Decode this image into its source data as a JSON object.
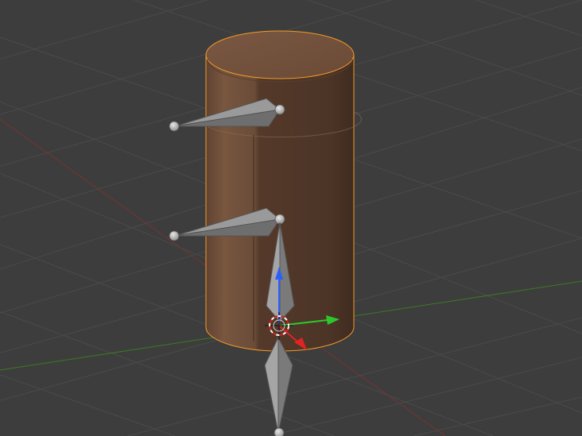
{
  "viewport": {
    "background": "#3d3d3d",
    "grid_color": "#4a4a4a",
    "x_axis_color": "#7a3232",
    "y_axis_color": "#3b7a23"
  },
  "scene": {
    "object": "cylinder",
    "object_color": "#6b4c38",
    "selection_outline_color": "#f39b28",
    "bones": [
      {
        "name": "upper-side-bone"
      },
      {
        "name": "middle-side-bone"
      },
      {
        "name": "vertical-upper-bone"
      },
      {
        "name": "vertical-lower-bone"
      }
    ]
  },
  "gizmo": {
    "z_color": "#2a5fff",
    "y_color": "#2cc72c",
    "x_color": "#e02424",
    "cursor": "3d-cursor"
  }
}
